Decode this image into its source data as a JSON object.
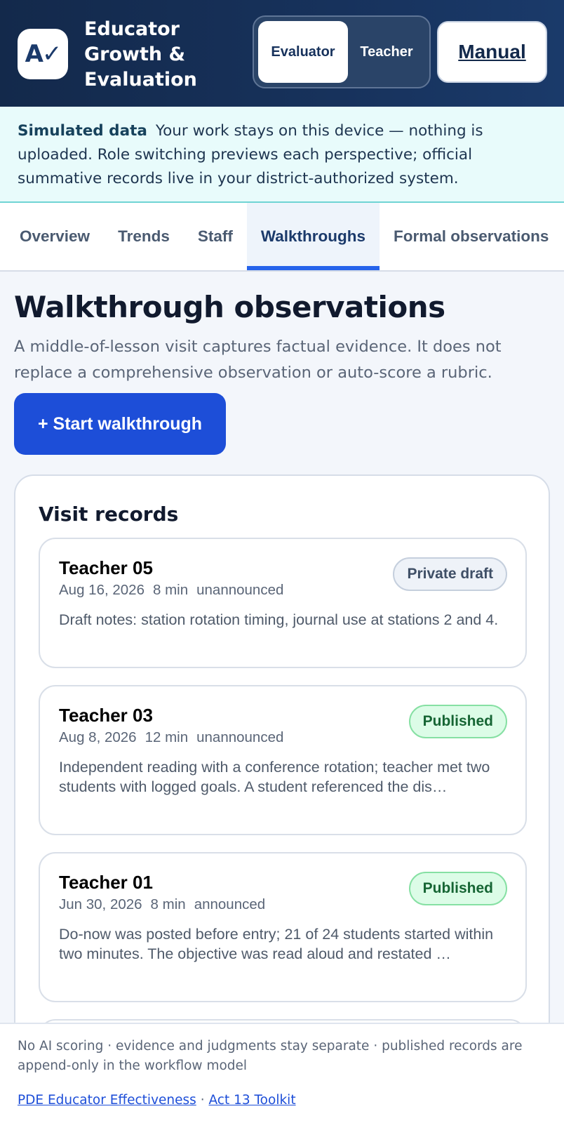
{
  "header": {
    "logo_text": "A✓",
    "title": "Educator Growth & Evaluation",
    "roles": [
      {
        "label": "Evaluator",
        "active": true
      },
      {
        "label": "Teacher",
        "active": false
      }
    ],
    "manual_label": "Manual"
  },
  "notice": {
    "heading": "Simulated data",
    "text": "Your work stays on this device — nothing is uploaded. Role switching previews each perspective; official summative records live in your district-authorized system."
  },
  "tabs": [
    {
      "label": "Overview",
      "active": false
    },
    {
      "label": "Trends",
      "active": false
    },
    {
      "label": "Staff",
      "active": false
    },
    {
      "label": "Walkthroughs",
      "active": true
    },
    {
      "label": "Formal observations",
      "active": false
    }
  ],
  "main": {
    "title": "Walkthrough observations",
    "description": "A middle-of-lesson visit captures factual evidence. It does not replace a comprehensive observation or auto-score a rubric.",
    "start_button": "+ Start walkthrough"
  },
  "records": {
    "title": "Visit records",
    "items": [
      {
        "teacher": "Teacher 05",
        "date": "Aug 16, 2026",
        "duration": "8 min",
        "type": "unannounced",
        "status": "Private draft",
        "status_kind": "draft",
        "notes": "Draft notes: station rotation timing, journal use at stations 2 and 4."
      },
      {
        "teacher": "Teacher 03",
        "date": "Aug 8, 2026",
        "duration": "12 min",
        "type": "unannounced",
        "status": "Published",
        "status_kind": "published",
        "notes": "Independent reading with a conference rotation; teacher met two students with logged goals. A student referenced the dis…"
      },
      {
        "teacher": "Teacher 01",
        "date": "Jun 30, 2026",
        "duration": "8 min",
        "type": "announced",
        "status": "Published",
        "status_kind": "published",
        "notes": "Do-now was posted before entry; 21 of 24 students started within two minutes. The objective was read aloud and restated …"
      }
    ]
  },
  "footer": {
    "text": "No AI scoring · evidence and judgments stay separate · published records are append-only in the workflow model",
    "links": [
      "PDE Educator Effectiveness",
      "Act 13 Toolkit"
    ],
    "separator": "·"
  }
}
